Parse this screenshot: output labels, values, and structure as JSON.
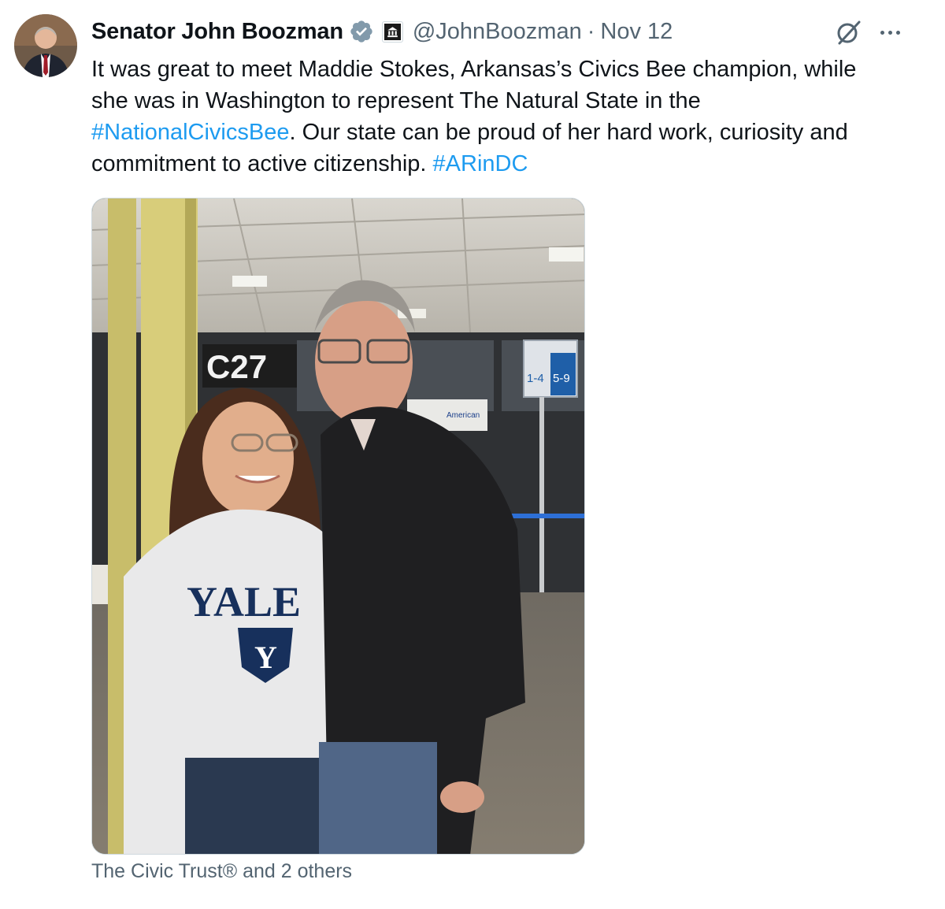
{
  "author": {
    "name": "Senator John Boozman",
    "handle": "@JohnBoozman",
    "separator": "·",
    "date": "Nov 12",
    "verified_icon": "verified-badge-icon",
    "affiliation_icon": "government-building-icon"
  },
  "tweet": {
    "line1": "It was great to meet Maddie Stokes, Arkansas’s Civics Bee champion, while",
    "line2": "she was in Washington to represent The Natural State in the",
    "hashtag1": "#NationalCivicsBee",
    "line3_rest": ". Our state can be proud of her hard work, curiosity and",
    "line4": "commitment to active citizenship. ",
    "hashtag2": "#ARinDC"
  },
  "photo": {
    "gate_sign": "C27",
    "sweatshirt_text": "YALE",
    "sweatshirt_emblem": "Y",
    "boarding_sign_left": "1-4",
    "boarding_sign_right": "5-9",
    "counter_brand": "American"
  },
  "tagged": "The Civic Trust® and 2 others",
  "colors": {
    "link": "#1d9bf0",
    "secondary_text": "#536471",
    "verified": "#829aab"
  }
}
